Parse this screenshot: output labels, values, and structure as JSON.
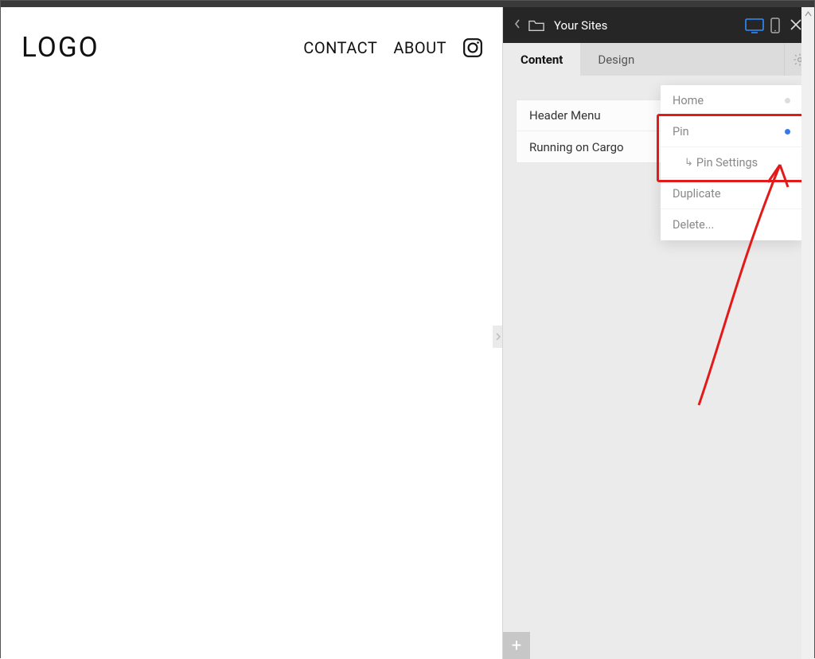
{
  "site": {
    "logo": "LOGO",
    "nav": {
      "contact": "CONTACT",
      "about": "ABOUT"
    }
  },
  "admin": {
    "breadcrumb_title": "Your Sites",
    "tabs": {
      "content": "Content",
      "design": "Design"
    },
    "pages": [
      {
        "label": "Header Menu"
      },
      {
        "label": "Running on Cargo"
      }
    ],
    "context_menu": {
      "home": "Home",
      "pin": "Pin",
      "pin_settings": "Pin  Settings",
      "duplicate": "Duplicate",
      "delete": "Delete..."
    },
    "add_label": "+"
  }
}
